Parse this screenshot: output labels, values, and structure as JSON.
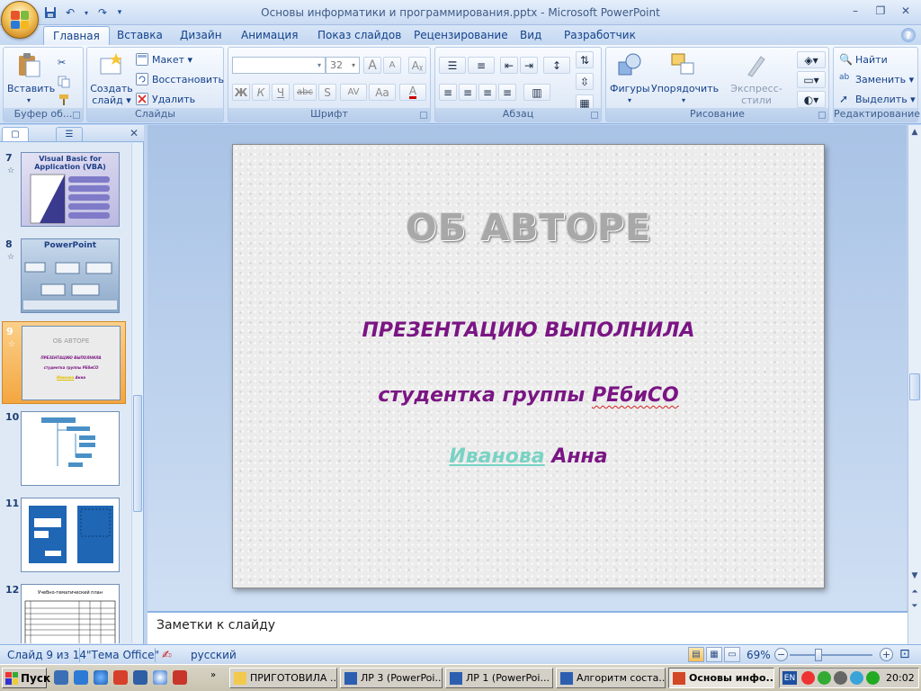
{
  "window": {
    "title": "Основы информатики и программирования.pptx - Microsoft PowerPoint",
    "controls": {
      "minimize": "–",
      "restore": "❐",
      "close": "✕"
    }
  },
  "quick_access": {
    "save_icon": "save-icon",
    "undo": "↶",
    "redo": "↷",
    "customize": "▾"
  },
  "ribbon": {
    "tabs": [
      "Главная",
      "Вставка",
      "Дизайн",
      "Анимация",
      "Показ слайдов",
      "Рецензирование",
      "Вид",
      "Разработчик"
    ],
    "active_tab": 0,
    "groups": {
      "clipboard": {
        "caption": "Буфер об...",
        "paste": "Вставить"
      },
      "slides": {
        "caption": "Слайды",
        "new_slide_line1": "Создать",
        "new_slide_line2": "слайд ▾",
        "layout": "Макет ▾",
        "reset": "Восстановить",
        "delete": "Удалить"
      },
      "font": {
        "caption": "Шрифт",
        "font_name": "",
        "font_size": "32",
        "bold": "Ж",
        "italic": "К",
        "underline": "Ч",
        "strike": "abc",
        "shadow": "S",
        "spacing": "AV",
        "case": "Aa",
        "grow": "A",
        "shrink": "A"
      },
      "paragraph": {
        "caption": "Абзац"
      },
      "drawing": {
        "caption": "Рисование",
        "shapes": "Фигуры",
        "arrange": "Упорядочить",
        "styles": "Экспресс-стили"
      },
      "editing": {
        "caption": "Редактирование",
        "find": "Найти",
        "replace": "Заменить ▾",
        "select": "Выделить ▾"
      }
    }
  },
  "thumbnails": [
    {
      "num": "7",
      "title": "Visual Basic for Application (VBA)"
    },
    {
      "num": "8",
      "title": "PowerPoint"
    },
    {
      "num": "9",
      "title": "ОБ АВТОРЕ",
      "l1": "ПРЕЗЕНТАЦИЮ ВЫПОЛНИЛА",
      "l2": "студентка группы РЕбиСО",
      "l3a": "Иванова",
      "l3b": "Анна"
    },
    {
      "num": "10"
    },
    {
      "num": "11"
    },
    {
      "num": "12",
      "title": "Учебно-тематический план"
    }
  ],
  "slide": {
    "title": "ОБ АВТОРЕ",
    "line1": "ПРЕЗЕНТАЦИЮ  ВЫПОЛНИЛА",
    "line2_prefix": "студентка группы ",
    "line2_group": "РЕбиСО",
    "line3_name": "Иванова",
    "line3_rest": " Анна"
  },
  "notes": {
    "text": "Заметки к слайду"
  },
  "status": {
    "slide_counter": "Слайд 9 из 14",
    "theme": "\"Тема Office\"",
    "language": "русский",
    "zoom": "69%",
    "zoom_fraction": 0.35
  },
  "taskbar": {
    "start": "Пуск",
    "items": [
      "ПРИГОТОВИЛА ...",
      "ЛР 3  (PowerPoi...",
      "ЛР 1  (PowerPoi...",
      "Алгоритм соста...",
      "Основы инфо..."
    ],
    "active_item": 4,
    "lang": "EN",
    "clock": "20:02"
  },
  "colors": {
    "accent_purple": "#7a1583",
    "link_teal": "#79d3c4",
    "ribbon_blue": "#15428b"
  }
}
